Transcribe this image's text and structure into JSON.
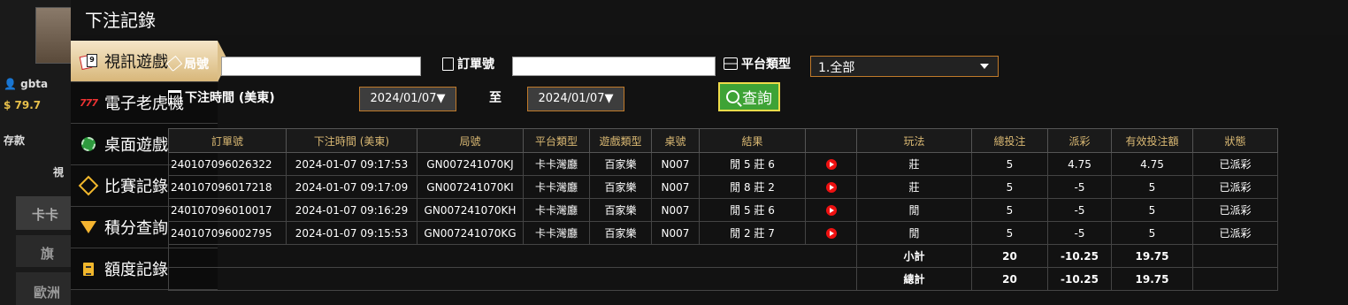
{
  "background": {
    "user_label": "gbta",
    "balance": "79.7",
    "deposit_label": "存款",
    "row4_text": "視",
    "row5_text": "卡卡",
    "row6_text": "旗",
    "row7_text": "歐洲"
  },
  "modal": {
    "title": "下注記錄"
  },
  "sidebar": {
    "items": [
      {
        "label": "視訊遊戲",
        "icon": "playing-cards-icon",
        "active": true
      },
      {
        "label": "電子老虎機",
        "icon": "slot-777-icon",
        "active": false
      },
      {
        "label": "桌面遊戲",
        "icon": "casino-chip-icon",
        "active": false
      },
      {
        "label": "比賽記錄",
        "icon": "diamond-icon",
        "active": false
      },
      {
        "label": "積分查詢",
        "icon": "gem-icon",
        "active": false
      },
      {
        "label": "額度記錄",
        "icon": "document-icon",
        "active": false
      }
    ]
  },
  "filters": {
    "round_label": "局號",
    "round_value": "",
    "order_label": "訂單號",
    "order_value": "",
    "platform_label": "平台類型",
    "platform_value": "1.全部",
    "time_label": "下注時間 (美東)",
    "date_from": "2024/01/07▼",
    "to_label": "至",
    "date_to": "2024/01/07▼",
    "query_button": "查詢"
  },
  "table": {
    "headers": [
      "訂單號",
      "下注時間 (美東)",
      "局號",
      "平台類型",
      "遊戲類型",
      "桌號",
      "結果",
      "",
      "玩法",
      "總投注",
      "派彩",
      "有效投注額",
      "狀態"
    ],
    "rows": [
      [
        "240107096026322",
        "2024-01-07 09:17:53",
        "GN007241070KJ",
        "卡卡灣廳",
        "百家樂",
        "N007",
        "閒 5 莊 6",
        "",
        "莊",
        "5",
        "4.75",
        "4.75",
        "已派彩"
      ],
      [
        "240107096017218",
        "2024-01-07 09:17:09",
        "GN007241070KI",
        "卡卡灣廳",
        "百家樂",
        "N007",
        "閒 8 莊 2",
        "",
        "莊",
        "5",
        "-5",
        "5",
        "已派彩"
      ],
      [
        "240107096010017",
        "2024-01-07 09:16:29",
        "GN007241070KH",
        "卡卡灣廳",
        "百家樂",
        "N007",
        "閒 5 莊 6",
        "",
        "閒",
        "5",
        "-5",
        "5",
        "已派彩"
      ],
      [
        "240107096002795",
        "2024-01-07 09:15:53",
        "GN007241070KG",
        "卡卡灣廳",
        "百家樂",
        "N007",
        "閒 2 莊 7",
        "",
        "閒",
        "5",
        "-5",
        "5",
        "已派彩"
      ]
    ],
    "subtotal": {
      "label": "小計",
      "bet": "20",
      "payout": "-10.25",
      "valid": "19.75"
    },
    "total": {
      "label": "總計",
      "bet": "20",
      "payout": "-10.25",
      "valid": "19.75"
    }
  },
  "colors": {
    "accent": "#d9b873",
    "win": "#3dd03d",
    "loss": "#e8303a",
    "settled": "#22d322",
    "sum": "#f1d73a",
    "query_bg": "#3ea336"
  }
}
